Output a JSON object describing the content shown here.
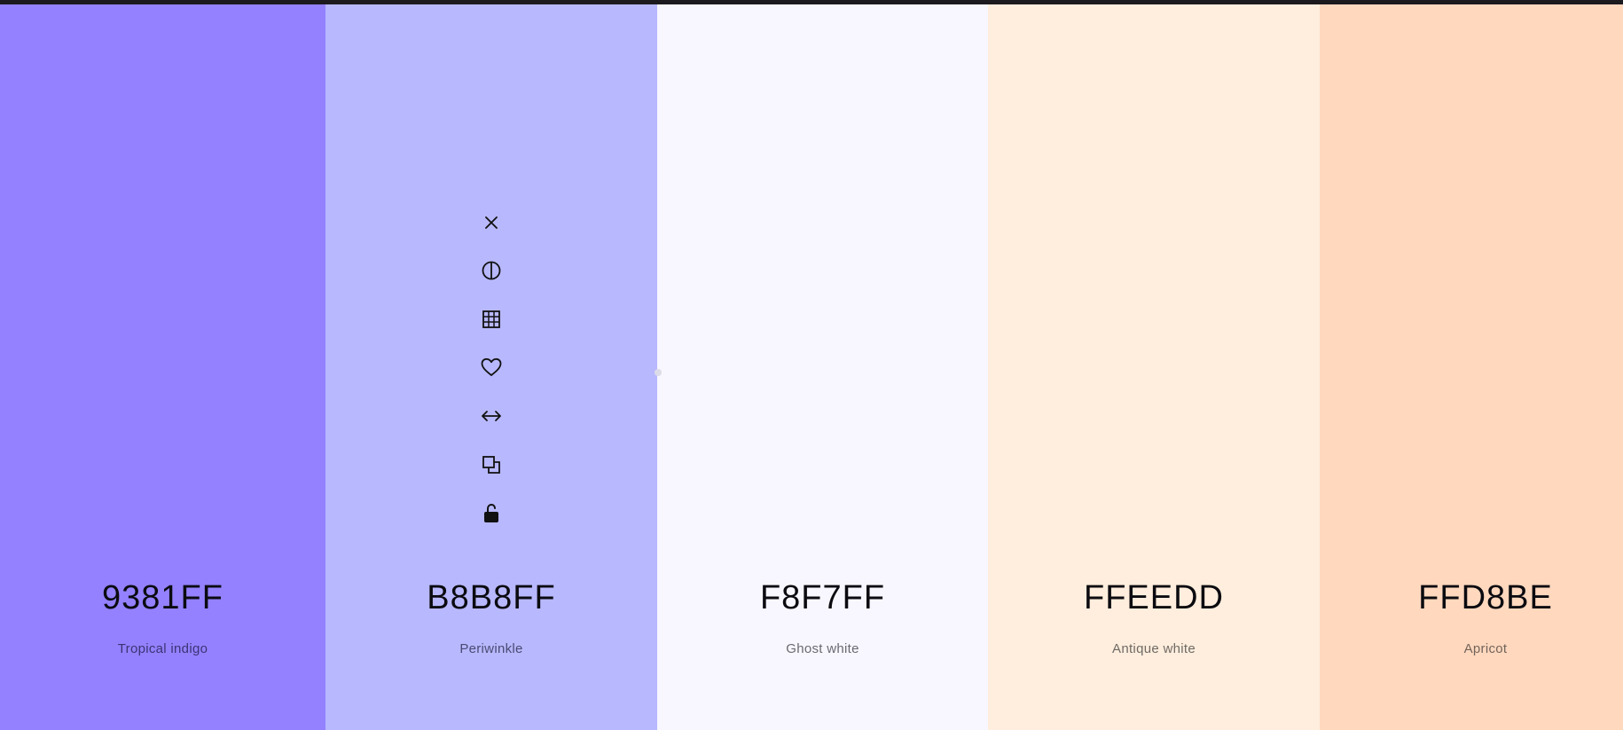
{
  "palette": {
    "swatches": [
      {
        "hex": "9381FF",
        "name": "Tropical indigo",
        "color": "#9381FF",
        "name_color": "#3b3473"
      },
      {
        "hex": "B8B8FF",
        "name": "Periwinkle",
        "color": "#B8B8FF",
        "name_color": "#4b4b73"
      },
      {
        "hex": "F8F7FF",
        "name": "Ghost white",
        "color": "#F8F7FF",
        "name_color": "#6a6a72"
      },
      {
        "hex": "FFEEDD",
        "name": "Antique white",
        "color": "#FFEEDD",
        "name_color": "#6f6a65"
      },
      {
        "hex": "FFD8BE",
        "name": "Apricot",
        "color": "#FFD8BE",
        "name_color": "#73655b"
      }
    ],
    "active_swatch_toolbar": {
      "tools": [
        {
          "icon": "close-icon",
          "label": "Remove"
        },
        {
          "icon": "contrast-icon",
          "label": "Shades"
        },
        {
          "icon": "grid-icon",
          "label": "View shades"
        },
        {
          "icon": "heart-icon",
          "label": "Save color"
        },
        {
          "icon": "drag-arrows-icon",
          "label": "Drag"
        },
        {
          "icon": "copy-icon",
          "label": "Copy hex"
        },
        {
          "icon": "unlocked-icon",
          "label": "Toggle lock"
        }
      ]
    }
  },
  "colors": {
    "topbar": "#1c1a1f",
    "text": "#0b0b10"
  }
}
